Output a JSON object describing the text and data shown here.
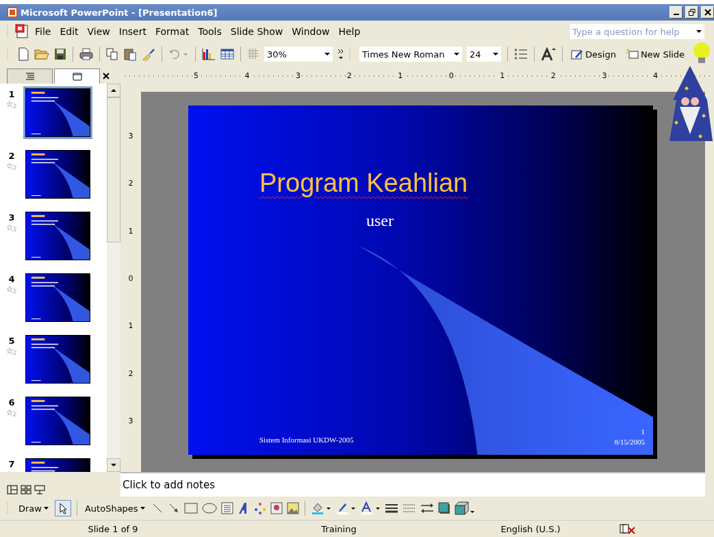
{
  "window": {
    "title": "Microsoft PowerPoint - [Presentation6]"
  },
  "menu": [
    "File",
    "Edit",
    "View",
    "Insert",
    "Format",
    "Tools",
    "Slide Show",
    "Window",
    "Help"
  ],
  "help_search": {
    "placeholder": "Type a question for help"
  },
  "toolbar": {
    "zoom": "30%",
    "font": "Times New Roman",
    "font_size": "24",
    "design": "Design",
    "new_slide": "New Slide"
  },
  "thumbnails": [
    {
      "number": "1",
      "selected": true
    },
    {
      "number": "2",
      "selected": false
    },
    {
      "number": "3",
      "selected": false
    },
    {
      "number": "4",
      "selected": false
    },
    {
      "number": "5",
      "selected": false
    },
    {
      "number": "6",
      "selected": false
    },
    {
      "number": "7",
      "selected": false
    }
  ],
  "ruler_h": [
    "5",
    "4",
    "3",
    "2",
    "1",
    "0",
    "1",
    "2",
    "3",
    "4"
  ],
  "ruler_v": [
    "3",
    "2",
    "1",
    "0",
    "1",
    "2",
    "3"
  ],
  "slide": {
    "title": "Program Keahlian",
    "subtitle": "user",
    "footer": "Sistem Informasi UKDW-2005",
    "number": "1",
    "date": "8/15/2005"
  },
  "notes": {
    "placeholder": "Click to add notes"
  },
  "draw_toolbar": {
    "draw": "Draw",
    "autoshapes": "AutoShapes"
  },
  "status_bar": [
    "Slide 1 of 9",
    "Training",
    "English (U.S.)"
  ]
}
